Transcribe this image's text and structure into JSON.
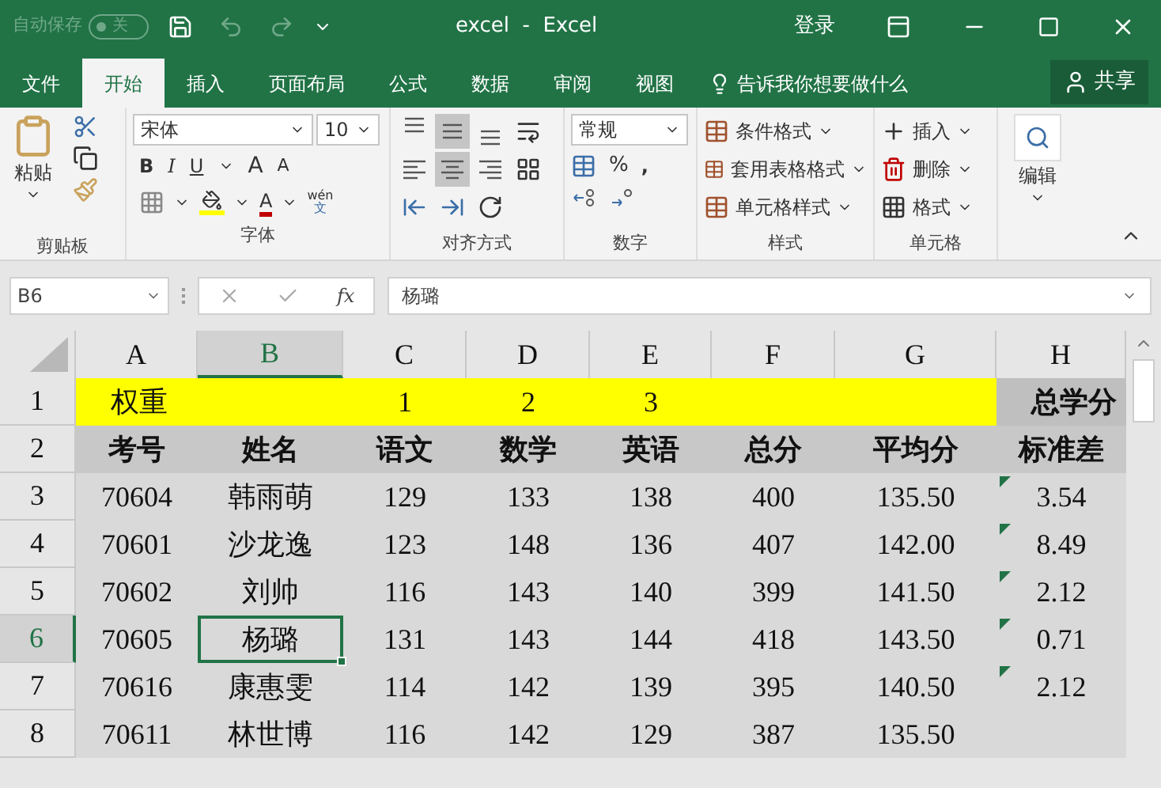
{
  "title_bar": {
    "autosave_label": "自动保存",
    "autosave_toggle": {
      "label": "关",
      "on": false
    },
    "title": "excel  -  Excel",
    "sign_in": "登录"
  },
  "tabs": [
    {
      "label": "文件",
      "selected": false
    },
    {
      "label": "开始",
      "selected": true
    },
    {
      "label": "插入",
      "selected": false
    },
    {
      "label": "页面布局",
      "selected": false
    },
    {
      "label": "公式",
      "selected": false
    },
    {
      "label": "数据",
      "selected": false
    },
    {
      "label": "审阅",
      "selected": false
    },
    {
      "label": "视图",
      "selected": false
    }
  ],
  "tell_me": "告诉我你想要做什么",
  "share": "共享",
  "ribbon": {
    "clipboard": {
      "paste": "粘贴",
      "label": "剪贴板"
    },
    "font": {
      "name": "宋体",
      "size": "10",
      "bold": "B",
      "italic": "I",
      "underline": "U",
      "grow": "A",
      "shrink": "A",
      "font_color": "A",
      "phonetic_top": "wén",
      "phonetic_bottom": "文",
      "label": "字体"
    },
    "alignment": {
      "buttons": [
        {
          "kind": "top",
          "selected": false
        },
        {
          "kind": "middle",
          "selected": true
        },
        {
          "kind": "bottom",
          "selected": false
        },
        {
          "kind": "left",
          "selected": false
        },
        {
          "kind": "center",
          "selected": true
        },
        {
          "kind": "right",
          "selected": false
        }
      ],
      "label": "对齐方式"
    },
    "number": {
      "format": "常规",
      "percent": "%",
      "comma": ",",
      "label": "数字"
    },
    "styles": {
      "items": [
        "条件格式",
        "套用表格格式",
        "单元格样式"
      ],
      "label": "样式"
    },
    "cells": {
      "items": [
        "插入",
        "删除",
        "格式"
      ],
      "label": "单元格"
    },
    "editing": {
      "label": "编辑"
    }
  },
  "formula_bar": {
    "name_box": "B6",
    "fx": "fx",
    "value": "杨璐"
  },
  "columns": [
    {
      "label": "A",
      "selected": false
    },
    {
      "label": "B",
      "selected": true
    },
    {
      "label": "C",
      "selected": false
    },
    {
      "label": "D",
      "selected": false
    },
    {
      "label": "E",
      "selected": false
    },
    {
      "label": "F",
      "selected": false
    },
    {
      "label": "G",
      "selected": false
    },
    {
      "label": "H",
      "selected": false
    }
  ],
  "rows": [
    {
      "header": "1",
      "kind": "weights",
      "selected": false,
      "cells": [
        {
          "text": "权重",
          "selected": false,
          "flag": false
        },
        {
          "selected": false,
          "flag": false
        },
        {
          "text": "1",
          "selected": false,
          "flag": false
        },
        {
          "text": "2",
          "selected": false,
          "flag": false
        },
        {
          "text": "3",
          "selected": false,
          "flag": false
        },
        {
          "selected": false,
          "flag": false
        },
        {
          "selected": false,
          "flag": false
        },
        {
          "text": "总学分",
          "selected": false,
          "flag": false
        }
      ]
    },
    {
      "header": "2",
      "kind": "heading",
      "selected": false,
      "cells": [
        {
          "text": "考号",
          "selected": false,
          "flag": false
        },
        {
          "text": "姓名",
          "selected": false,
          "flag": false
        },
        {
          "text": "语文",
          "selected": false,
          "flag": false
        },
        {
          "text": "数学",
          "selected": false,
          "flag": false
        },
        {
          "text": "英语",
          "selected": false,
          "flag": false
        },
        {
          "text": "总分",
          "selected": false,
          "flag": false
        },
        {
          "text": "平均分",
          "selected": false,
          "flag": false
        },
        {
          "text": "标准差",
          "selected": false,
          "flag": false
        }
      ]
    },
    {
      "header": "3",
      "kind": "data",
      "selected": false,
      "cells": [
        {
          "text": "70604",
          "selected": false,
          "flag": false
        },
        {
          "text": "韩雨萌",
          "selected": false,
          "flag": false
        },
        {
          "text": "129",
          "selected": false,
          "flag": false
        },
        {
          "text": "133",
          "selected": false,
          "flag": false
        },
        {
          "text": "138",
          "selected": false,
          "flag": false
        },
        {
          "text": "400",
          "selected": false,
          "flag": false
        },
        {
          "text": "135.50",
          "selected": false,
          "flag": false
        },
        {
          "text": "3.54",
          "selected": false,
          "flag": true
        }
      ]
    },
    {
      "header": "4",
      "kind": "data",
      "selected": false,
      "cells": [
        {
          "text": "70601",
          "selected": false,
          "flag": false
        },
        {
          "text": "沙龙逸",
          "selected": false,
          "flag": false
        },
        {
          "text": "123",
          "selected": false,
          "flag": false
        },
        {
          "text": "148",
          "selected": false,
          "flag": false
        },
        {
          "text": "136",
          "selected": false,
          "flag": false
        },
        {
          "text": "407",
          "selected": false,
          "flag": false
        },
        {
          "text": "142.00",
          "selected": false,
          "flag": false
        },
        {
          "text": "8.49",
          "selected": false,
          "flag": true
        }
      ]
    },
    {
      "header": "5",
      "kind": "data",
      "selected": false,
      "cells": [
        {
          "text": "70602",
          "selected": false,
          "flag": false
        },
        {
          "text": "刘帅",
          "selected": false,
          "flag": false
        },
        {
          "text": "116",
          "selected": false,
          "flag": false
        },
        {
          "text": "143",
          "selected": false,
          "flag": false
        },
        {
          "text": "140",
          "selected": false,
          "flag": false
        },
        {
          "text": "399",
          "selected": false,
          "flag": false
        },
        {
          "text": "141.50",
          "selected": false,
          "flag": false
        },
        {
          "text": "2.12",
          "selected": false,
          "flag": true
        }
      ]
    },
    {
      "header": "6",
      "kind": "data",
      "selected": true,
      "cells": [
        {
          "text": "70605",
          "selected": false,
          "flag": false
        },
        {
          "text": "杨璐",
          "selected": true,
          "flag": false
        },
        {
          "text": "131",
          "selected": false,
          "flag": false
        },
        {
          "text": "143",
          "selected": false,
          "flag": false
        },
        {
          "text": "144",
          "selected": false,
          "flag": false
        },
        {
          "text": "418",
          "selected": false,
          "flag": false
        },
        {
          "text": "143.50",
          "selected": false,
          "flag": false
        },
        {
          "text": "0.71",
          "selected": false,
          "flag": true
        }
      ]
    },
    {
      "header": "7",
      "kind": "data",
      "selected": false,
      "cells": [
        {
          "text": "70616",
          "selected": false,
          "flag": false
        },
        {
          "text": "康惠雯",
          "selected": false,
          "flag": false
        },
        {
          "text": "114",
          "selected": false,
          "flag": false
        },
        {
          "text": "142",
          "selected": false,
          "flag": false
        },
        {
          "text": "139",
          "selected": false,
          "flag": false
        },
        {
          "text": "395",
          "selected": false,
          "flag": false
        },
        {
          "text": "140.50",
          "selected": false,
          "flag": false
        },
        {
          "text": "2.12",
          "selected": false,
          "flag": true
        }
      ]
    },
    {
      "header": "8",
      "kind": "data",
      "selected": false,
      "cells": [
        {
          "text": "70611",
          "selected": false,
          "flag": false
        },
        {
          "text": "林世博",
          "selected": false,
          "flag": false
        },
        {
          "text": "116",
          "selected": false,
          "flag": false
        },
        {
          "text": "142",
          "selected": false,
          "flag": false
        },
        {
          "text": "129",
          "selected": false,
          "flag": false
        },
        {
          "text": "387",
          "selected": false,
          "flag": false
        },
        {
          "text": "135.50",
          "selected": false,
          "flag": false
        },
        {
          "selected": false,
          "flag": false
        }
      ]
    }
  ]
}
